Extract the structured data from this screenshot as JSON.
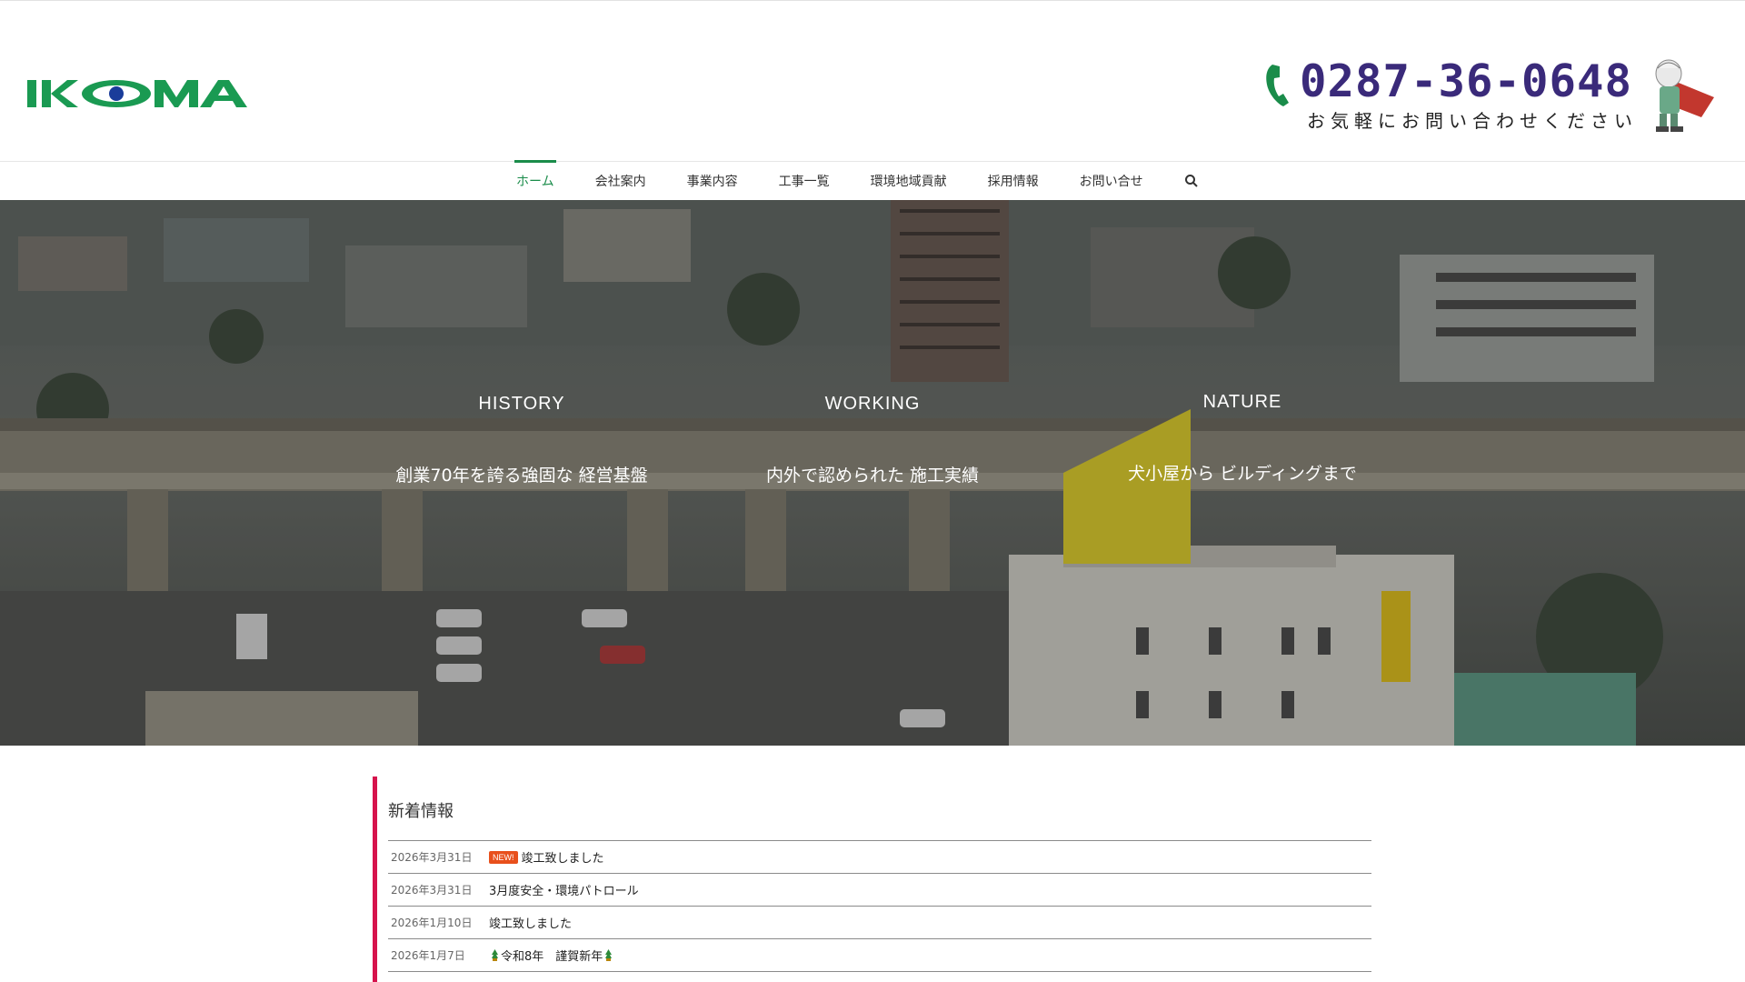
{
  "header": {
    "logo_text": "IKOMA",
    "phone": "0287-36-0648",
    "phone_note": "お気軽にお問い合わせください",
    "brand_green": "#1a9a52",
    "brand_blue": "#1a3c9a",
    "phone_color": "#3a2a7a"
  },
  "nav": {
    "items": [
      {
        "label": "ホーム",
        "active": true
      },
      {
        "label": "会社案内"
      },
      {
        "label": "事業内容"
      },
      {
        "label": "工事一覧"
      },
      {
        "label": "環境地域貢献"
      },
      {
        "label": "採用情報"
      },
      {
        "label": "お問い合せ"
      }
    ],
    "search_icon": "search-icon",
    "accent": "#1a8c4a"
  },
  "hero": {
    "columns": [
      {
        "title": "HISTORY",
        "subtitle": "創業70年を誇る強固な 経営基盤"
      },
      {
        "title": "WORKING",
        "subtitle": "内外で認められた 施工実績"
      },
      {
        "title": "NATURE",
        "subtitle": "犬小屋から ビルディングまで"
      }
    ]
  },
  "news": {
    "title": "新着情報",
    "accent": "#d6134c",
    "badge_label": "NEW!",
    "items": [
      {
        "date": "2026年3月31日",
        "text": "竣工致しました",
        "new": true
      },
      {
        "date": "2026年3月31日",
        "text": "3月度安全・環境パトロール"
      },
      {
        "date": "2026年1月10日",
        "text": "竣工致しました"
      },
      {
        "date": "2026年1月7日",
        "text": "令和8年　謹賀新年",
        "leaf": true
      }
    ]
  }
}
